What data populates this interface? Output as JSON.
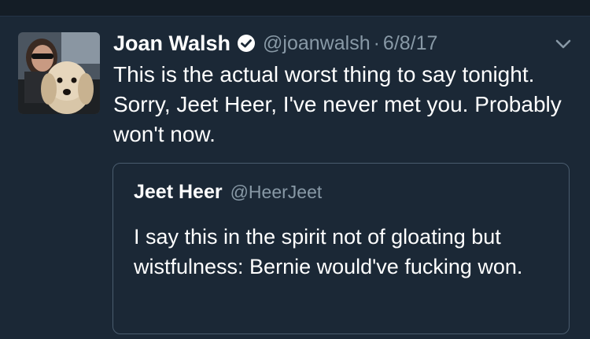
{
  "tweet": {
    "author_name": "Joan Walsh",
    "handle": "@joanwalsh",
    "separator": "·",
    "date": "6/8/17",
    "text": "This is the actual worst thing to say tonight. Sorry, Jeet Heer, I've never met you. Probably won't now.",
    "verified_icon": "verified-badge-icon",
    "menu_icon": "chevron-down-icon"
  },
  "quoted_tweet": {
    "author_name": "Jeet Heer",
    "handle": "@HeerJeet",
    "text": "I say this in the spirit not of gloating but wistfulness: Bernie would've fucking won."
  },
  "colors": {
    "background": "#1b2836",
    "top_strip": "#141d26",
    "primary_text": "#ffffff",
    "secondary_text": "#8899a6",
    "quote_border": "#4a5c6e"
  }
}
